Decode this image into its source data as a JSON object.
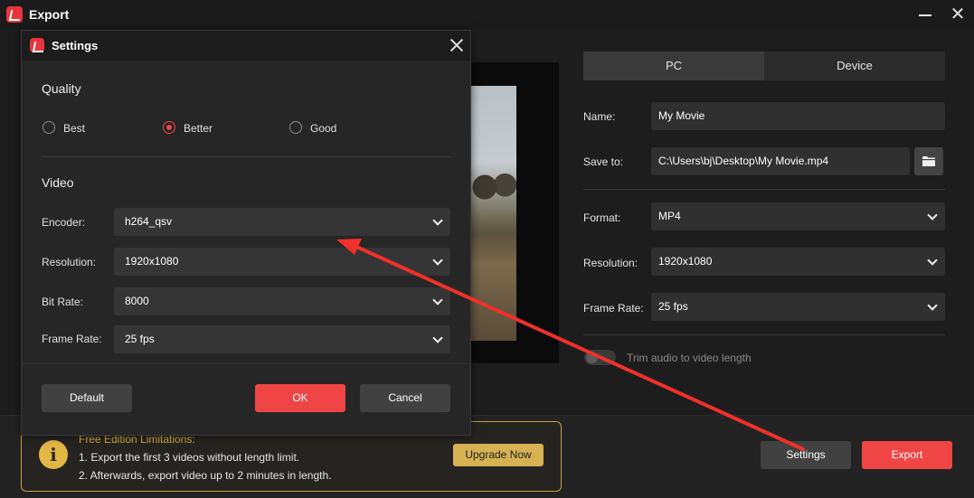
{
  "window": {
    "title": "Export"
  },
  "preview": {},
  "right_panel": {
    "tabs": [
      "PC",
      "Device"
    ],
    "name_label": "Name:",
    "name_value": "My Movie",
    "save_label": "Save to:",
    "save_value": "C:\\Users\\bj\\Desktop\\My Movie.mp4",
    "format_label": "Format:",
    "format_value": "MP4",
    "resolution_label": "Resolution:",
    "resolution_value": "1920x1080",
    "framerate_label": "Frame Rate:",
    "framerate_value": "25 fps",
    "trim_label": "Trim audio to video length"
  },
  "bottom": {
    "limit_title": "Free Edition Limitations:",
    "limit_line1": "1. Export the first 3 videos without length limit.",
    "limit_line2": "2. Afterwards, export video up to 2 minutes in length.",
    "upgrade_label": "Upgrade Now",
    "settings_label": "Settings",
    "export_label": "Export"
  },
  "dialog": {
    "title": "Settings",
    "quality_heading": "Quality",
    "quality_options": [
      "Best",
      "Better",
      "Good"
    ],
    "quality_selected": "Better",
    "video_heading": "Video",
    "encoder_label": "Encoder:",
    "encoder_value": "h264_qsv",
    "resolution_label": "Resolution:",
    "resolution_value": "1920x1080",
    "bitrate_label": "Bit Rate:",
    "bitrate_value": "8000",
    "framerate_label": "Frame Rate:",
    "framerate_value": "25 fps",
    "default_label": "Default",
    "ok_label": "OK",
    "cancel_label": "Cancel"
  },
  "colors": {
    "accent": "#ef4545",
    "upgrade": "#d6b253",
    "annotation_arrow": "#f0302a"
  }
}
